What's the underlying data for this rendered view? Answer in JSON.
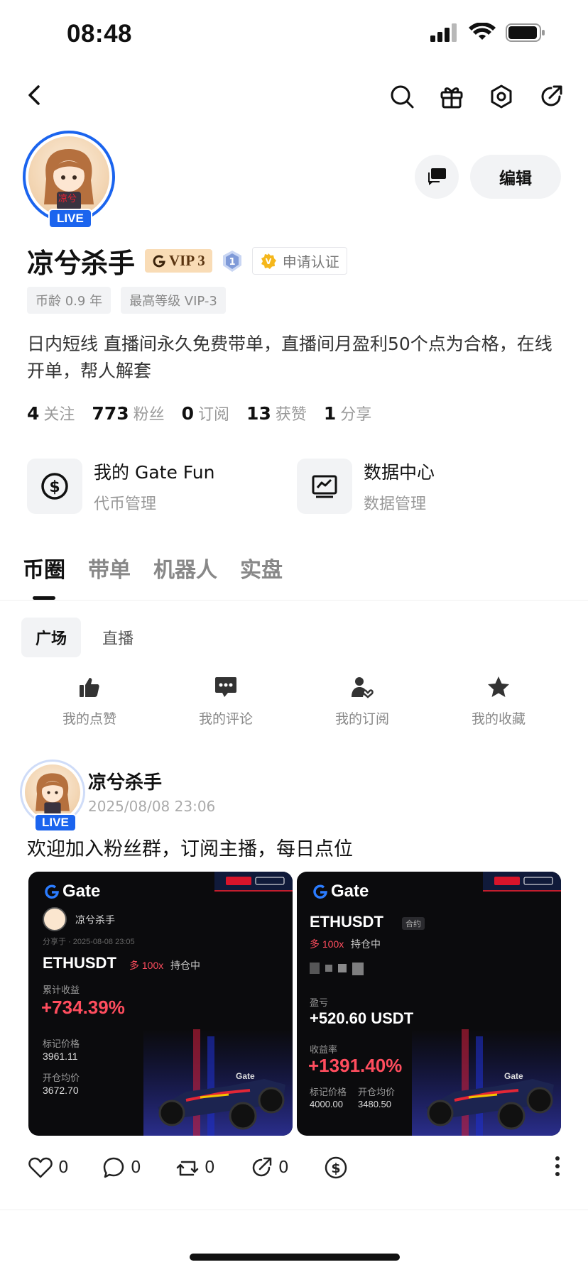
{
  "status_bar": {
    "time": "08:48"
  },
  "nav": {
    "back_icon": "chevron-left-icon",
    "icons": [
      "search-icon",
      "gift-icon",
      "settings-icon",
      "share-icon"
    ]
  },
  "profile": {
    "live_label": "LIVE",
    "edit_label": "编辑",
    "username": "凉兮杀手",
    "vip_label": "VIP 3",
    "level_label": "1",
    "verify_label": "申请认证",
    "tags": [
      "币龄 0.9 年",
      "最高等级 VIP-3"
    ],
    "bio": "日内短线 直播间永久免费带单，直播间月盈利50个点为合格，在线开单，帮人解套",
    "stats": [
      {
        "num": "4",
        "label": "关注"
      },
      {
        "num": "773",
        "label": "粉丝"
      },
      {
        "num": "0",
        "label": "订阅"
      },
      {
        "num": "13",
        "label": "获赞"
      },
      {
        "num": "1",
        "label": "分享"
      }
    ]
  },
  "tools": [
    {
      "title": "我的 Gate Fun",
      "subtitle": "代币管理",
      "icon": "dollar-circle-icon"
    },
    {
      "title": "数据中心",
      "subtitle": "数据管理",
      "icon": "chart-monitor-icon"
    }
  ],
  "tabs": [
    "币圈",
    "带单",
    "机器人",
    "实盘"
  ],
  "subtabs": [
    "广场",
    "直播"
  ],
  "quick_links": [
    {
      "label": "我的点赞",
      "icon": "thumbs-up-icon"
    },
    {
      "label": "我的评论",
      "icon": "comment-icon"
    },
    {
      "label": "我的订阅",
      "icon": "subscribe-user-icon"
    },
    {
      "label": "我的收藏",
      "icon": "star-icon"
    }
  ],
  "post": {
    "author": "凉兮杀手",
    "live_label": "LIVE",
    "time": "2025/08/08 23:06",
    "text": "欢迎加入粉丝群，订阅主播，每日点位",
    "card1": {
      "logo": "Gate",
      "user": "凉兮杀手",
      "shared": "分享于 · 2025-08-08 23:05",
      "pair": "ETHUSDT",
      "direction": "多 100x",
      "status": "持仓中",
      "pnl_label": "累计收益",
      "pnl": "+734.39%",
      "mark_label": "标记价格",
      "mark": "3961.11",
      "entry_label": "开仓均价",
      "entry": "3672.70"
    },
    "card2": {
      "logo": "Gate",
      "pair": "ETHUSDT",
      "contract": "合约",
      "direction": "多 100x",
      "status": "持仓中",
      "pl_label": "盈亏",
      "pl": "+520.60 USDT",
      "rate_label": "收益率",
      "rate": "+1391.40%",
      "mark_label": "标记价格",
      "mark": "4000.00",
      "entry_label": "开仓均价",
      "entry": "3480.50"
    },
    "actions": [
      {
        "icon": "heart-icon",
        "count": "0"
      },
      {
        "icon": "comment-bubble-icon",
        "count": "0"
      },
      {
        "icon": "repost-icon",
        "count": "0"
      },
      {
        "icon": "share-icon",
        "count": "0"
      }
    ]
  },
  "colors": {
    "accent": "#1b64ee",
    "profit": "#ff4d5e",
    "vip_bg": "#f9dcb6"
  }
}
